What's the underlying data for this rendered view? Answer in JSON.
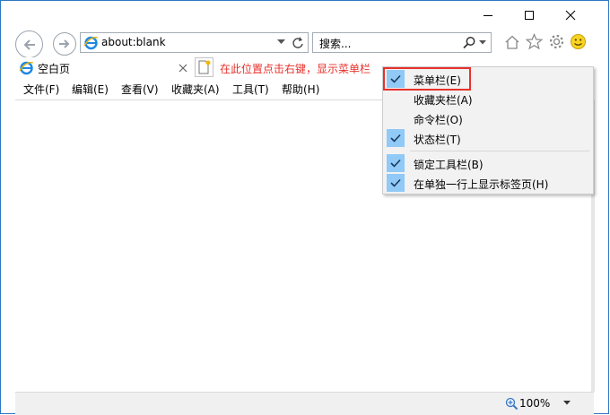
{
  "window": {
    "address": "about:blank",
    "search_placeholder": "搜索...",
    "tab_title": "空白页",
    "annotation": "在此位置点击右键，显示菜单栏",
    "zoom": "100%"
  },
  "menu": [
    "文件(F)",
    "编辑(E)",
    "查看(V)",
    "收藏夹(A)",
    "工具(T)",
    "帮助(H)"
  ],
  "context_menu": [
    {
      "label": "菜单栏(E)",
      "checked": true
    },
    {
      "label": "收藏夹栏(A)",
      "checked": false
    },
    {
      "label": "命令栏(O)",
      "checked": false
    },
    {
      "label": "状态栏(T)",
      "checked": true
    },
    {
      "label": "锁定工具栏(B)",
      "checked": true
    },
    {
      "label": "在单独一行上显示标签页(H)",
      "checked": true
    }
  ],
  "colors": {
    "annotation_red": "#e8312c",
    "check_blue": "#91c9f7",
    "ie_blue": "#1e88e5"
  }
}
